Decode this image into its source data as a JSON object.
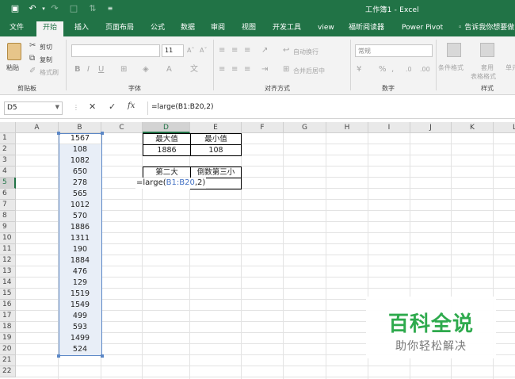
{
  "window": {
    "title": "工作簿1 - Excel"
  },
  "tabs": [
    "文件",
    "开始",
    "插入",
    "页面布局",
    "公式",
    "数据",
    "审阅",
    "视图",
    "开发工具",
    "view",
    "福昕阅读器",
    "Power Pivot"
  ],
  "active_tab": "开始",
  "tell_me": "告诉我你想要做",
  "ribbon": {
    "clipboard": {
      "paste": "粘贴",
      "cut": "剪切",
      "copy": "复制",
      "format_painter": "格式刷",
      "label": "剪贴板"
    },
    "font": {
      "size": "11",
      "label": "字体"
    },
    "alignment": {
      "wrap_text": "自动换行",
      "merge_center": "合并后居中",
      "label": "对齐方式"
    },
    "number": {
      "format": "常规",
      "label": "数字"
    },
    "styles": {
      "conditional": "条件格式",
      "table_format_1": "套用",
      "table_format_2": "表格格式",
      "cell_styles": "单元",
      "label": "样式"
    }
  },
  "formula_bar": {
    "name_box": "D5",
    "formula": "=large(B1:B20,2)"
  },
  "grid": {
    "columns": [
      "A",
      "B",
      "C",
      "D",
      "E",
      "F",
      "G",
      "H",
      "I",
      "J",
      "K",
      "L"
    ],
    "rows": [
      "1",
      "2",
      "3",
      "4",
      "5",
      "6",
      "7",
      "8",
      "9",
      "10",
      "11",
      "12",
      "13",
      "14",
      "15",
      "16",
      "17",
      "18",
      "19",
      "20",
      "21",
      "22"
    ],
    "column_b": [
      "1567",
      "108",
      "1082",
      "650",
      "278",
      "565",
      "1012",
      "570",
      "1886",
      "1311",
      "190",
      "1884",
      "476",
      "129",
      "1519",
      "1549",
      "499",
      "593",
      "1499",
      "524"
    ],
    "d1": "最大值",
    "e1": "最小值",
    "d2": "1886",
    "e2": "108",
    "d4": "第二大",
    "e4": "倒数第三小",
    "editing": {
      "prefix": "=large(",
      "ref": "B1:B20",
      "suffix": ",2)"
    }
  },
  "watermark": {
    "title": "百科全说",
    "subtitle": "助你轻松解决"
  }
}
